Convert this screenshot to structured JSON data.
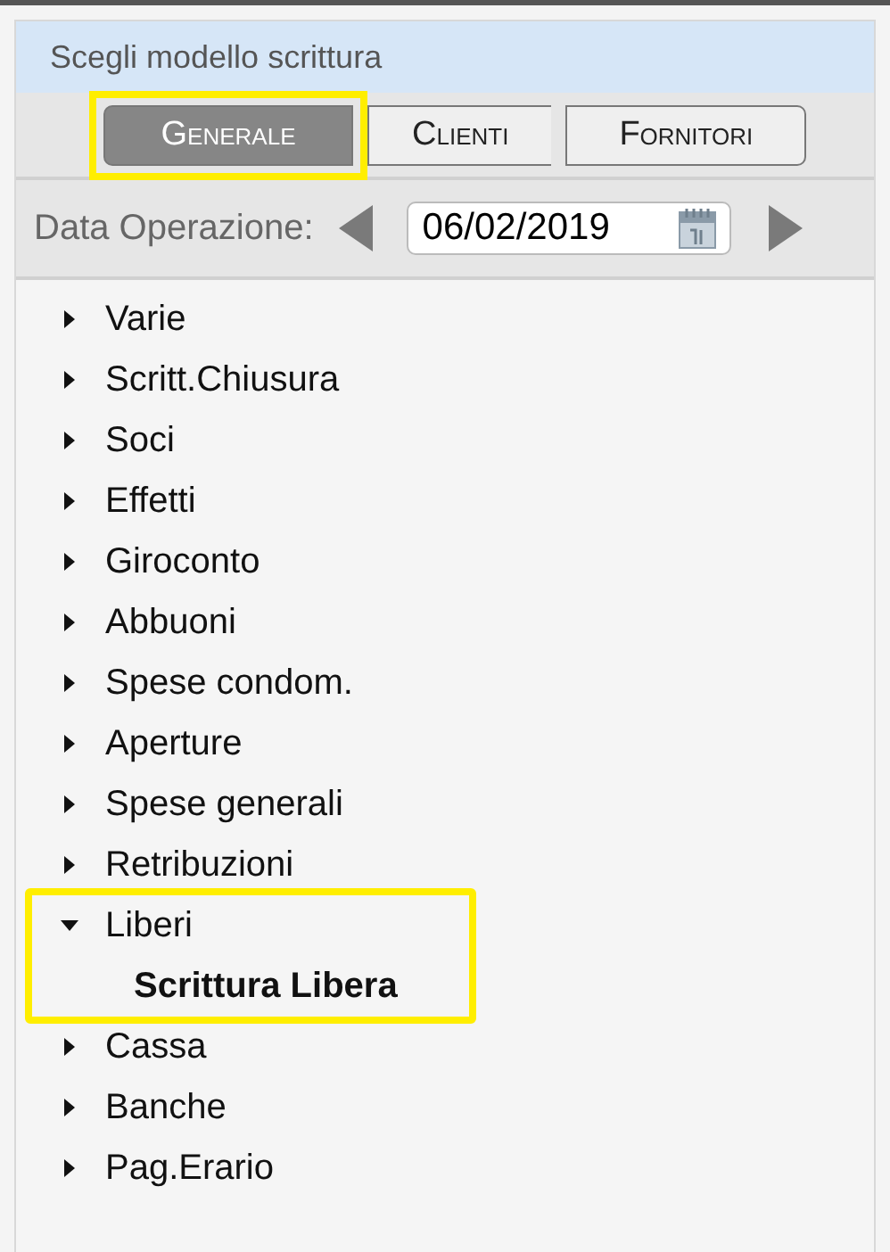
{
  "panel": {
    "title": "Scegli modello scrittura"
  },
  "tabs": [
    {
      "label": "Generale",
      "selected": true,
      "highlighted": true
    },
    {
      "label": "Clienti",
      "selected": false,
      "highlighted": false
    },
    {
      "label": "Fornitori",
      "selected": false,
      "highlighted": false
    }
  ],
  "date": {
    "label": "Data Operazione:",
    "value": "06/02/2019"
  },
  "tree": [
    {
      "label": "Varie",
      "kind": "folder",
      "expanded": false,
      "highlighted": false
    },
    {
      "label": "Scritt.Chiusura",
      "kind": "folder",
      "expanded": false,
      "highlighted": false
    },
    {
      "label": "Soci",
      "kind": "folder",
      "expanded": false,
      "highlighted": false
    },
    {
      "label": "Effetti",
      "kind": "folder",
      "expanded": false,
      "highlighted": false
    },
    {
      "label": "Giroconto",
      "kind": "folder",
      "expanded": false,
      "highlighted": false
    },
    {
      "label": "Abbuoni",
      "kind": "folder",
      "expanded": false,
      "highlighted": false
    },
    {
      "label": "Spese condom.",
      "kind": "folder",
      "expanded": false,
      "highlighted": false
    },
    {
      "label": "Aperture",
      "kind": "folder",
      "expanded": false,
      "highlighted": false
    },
    {
      "label": "Spese generali",
      "kind": "folder",
      "expanded": false,
      "highlighted": false
    },
    {
      "label": "Retribuzioni",
      "kind": "folder",
      "expanded": false,
      "highlighted": false
    },
    {
      "label": "Liberi",
      "kind": "folder",
      "expanded": true,
      "highlighted": true,
      "children": [
        {
          "label": "Scrittura Libera",
          "kind": "entry"
        }
      ]
    },
    {
      "label": "Cassa",
      "kind": "folder",
      "expanded": false,
      "highlighted": false
    },
    {
      "label": "Banche",
      "kind": "folder",
      "expanded": false,
      "highlighted": false
    },
    {
      "label": "Pag.Erario",
      "kind": "folder",
      "expanded": false,
      "highlighted": false
    }
  ]
}
